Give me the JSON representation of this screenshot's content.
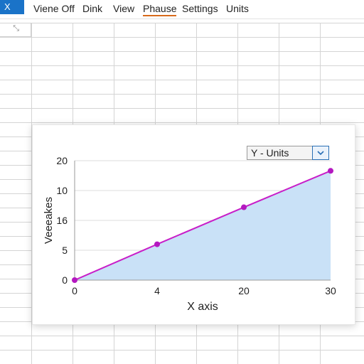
{
  "app": {
    "badge": "X"
  },
  "menu": {
    "items": [
      "Viene Off",
      "Dink",
      "View",
      "Phause",
      "Settings",
      "Units"
    ],
    "active_index": 3
  },
  "sheet": {
    "corner_mark": "⤡"
  },
  "chart": {
    "dropdown": {
      "label": "Y - Units",
      "icon": "chevron-down-icon"
    }
  },
  "chart_data": {
    "type": "area",
    "x": [
      0,
      4,
      20,
      30
    ],
    "y": [
      0,
      6,
      12.2,
      18.3
    ],
    "x_tick_labels": [
      "0",
      "4",
      "20",
      "30"
    ],
    "y_tick_labels": [
      "0",
      "5",
      "16",
      "10",
      "20"
    ],
    "xlabel": "X axis",
    "ylabel": "Veeeakes",
    "ylim": [
      0,
      20
    ],
    "grid": true,
    "colors": {
      "line": "#c81ec8",
      "fill": "#c9e1f7",
      "marker": "#b418c0"
    }
  }
}
